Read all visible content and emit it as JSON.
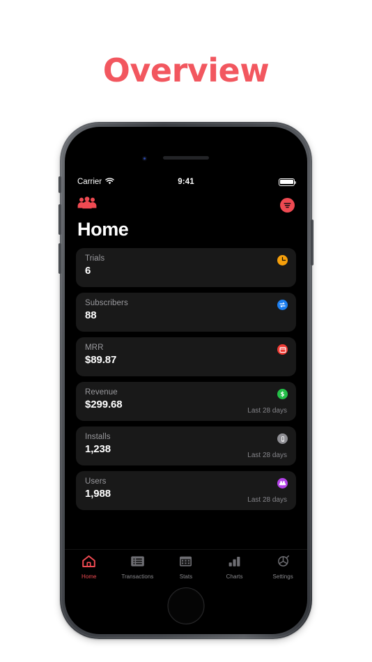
{
  "page": {
    "title": "Overview",
    "title_color": "#f2575f"
  },
  "phone": {
    "status_bar": {
      "carrier": "Carrier",
      "wifi_icon": "wifi-icon",
      "time": "9:41",
      "battery_icon": "battery-full-icon"
    },
    "nav": {
      "left_icon": "people-group-icon",
      "right_icon": "filter-menu-icon",
      "accent_color": "#ef4a52"
    },
    "screen_title": "Home",
    "cards": [
      {
        "label": "Trials",
        "value": "6",
        "period": "",
        "icon": "clock-icon",
        "icon_color": "#f59f0b"
      },
      {
        "label": "Subscribers",
        "value": "88",
        "period": "",
        "icon": "repeat-icon",
        "icon_color": "#1d7ff0"
      },
      {
        "label": "MRR",
        "value": "$89.87",
        "period": "",
        "icon": "calendar-icon",
        "icon_color": "#f03b34"
      },
      {
        "label": "Revenue",
        "value": "$299.68",
        "period": "Last 28 days",
        "icon": "dollar-icon",
        "icon_color": "#24c048"
      },
      {
        "label": "Installs",
        "value": "1,238",
        "period": "Last 28 days",
        "icon": "phone-icon",
        "icon_color": "#8e8e93"
      },
      {
        "label": "Users",
        "value": "1,988",
        "period": "Last 28 days",
        "icon": "users-icon",
        "icon_color": "#b442e8"
      }
    ],
    "tabs": [
      {
        "label": "Home",
        "icon": "house-icon",
        "active": true
      },
      {
        "label": "Transactions",
        "icon": "list-icon",
        "active": false
      },
      {
        "label": "Stats",
        "icon": "calendar-grid-icon",
        "active": false
      },
      {
        "label": "Charts",
        "icon": "bar-chart-icon",
        "active": false
      },
      {
        "label": "Settings",
        "icon": "gear-icon",
        "active": false
      }
    ],
    "hardware": {
      "speaker": "earpiece-speaker",
      "camera": "front-camera",
      "home_button": "home-button"
    }
  }
}
